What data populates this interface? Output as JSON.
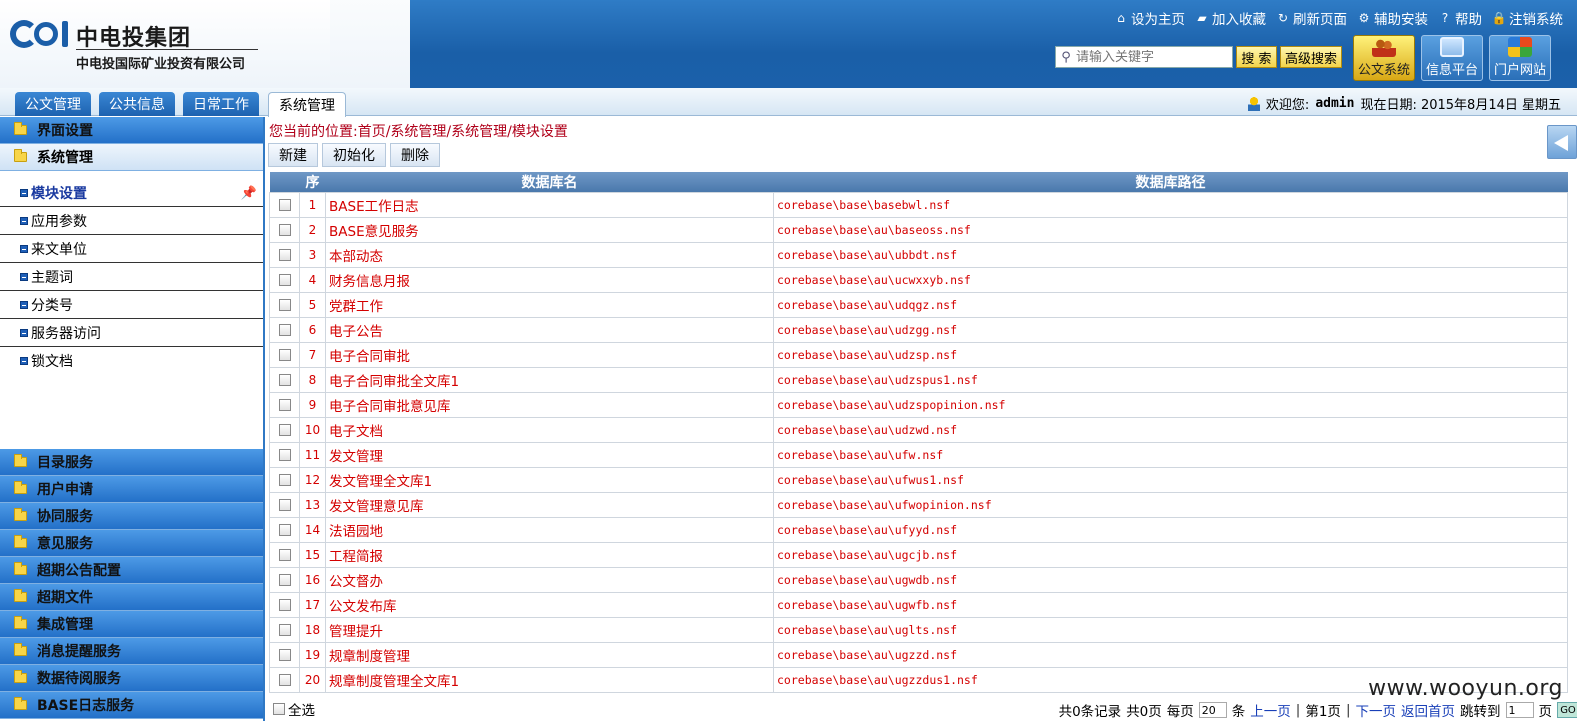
{
  "brand": {
    "title": "中电投集团",
    "subtitle": "中电投国际矿业投资有限公司",
    "color": "#1b5ea8"
  },
  "top_links": [
    {
      "label": "设为主页",
      "icon": "home-icon"
    },
    {
      "label": "加入收藏",
      "icon": "folder-icon"
    },
    {
      "label": "刷新页面",
      "icon": "refresh-icon"
    },
    {
      "label": "辅助安装",
      "icon": "gear-icon"
    },
    {
      "label": "帮助",
      "icon": "help-icon"
    },
    {
      "label": "注销系统",
      "icon": "lock-icon"
    }
  ],
  "search": {
    "placeholder": "请输入关键字",
    "search_label": "搜 索",
    "advanced_label": "高级搜索"
  },
  "apps": [
    {
      "label": "公文系统",
      "icon": "users-icon",
      "active": true
    },
    {
      "label": "信息平台",
      "icon": "monitor-icon",
      "active": false
    },
    {
      "label": "门户网站",
      "icon": "windows-icon",
      "active": false
    }
  ],
  "nav_tabs": [
    {
      "label": "公文管理"
    },
    {
      "label": "公共信息"
    },
    {
      "label": "日常工作"
    },
    {
      "label": "系统管理",
      "active": true
    }
  ],
  "welcome": {
    "text": "欢迎您:",
    "user": "admin",
    "date": "现在日期: 2015年8月14日 星期五"
  },
  "sidebar": {
    "top_groups": [
      {
        "label": "界面设置"
      },
      {
        "label": "系统管理"
      }
    ],
    "items": [
      {
        "label": "模块设置",
        "active": true
      },
      {
        "label": "应用参数"
      },
      {
        "label": "来文单位"
      },
      {
        "label": "主题词"
      },
      {
        "label": "分类号"
      },
      {
        "label": "服务器访问"
      },
      {
        "label": "锁文档"
      }
    ],
    "bottom_groups": [
      {
        "label": "目录服务"
      },
      {
        "label": "用户申请"
      },
      {
        "label": "协同服务"
      },
      {
        "label": "意见服务"
      },
      {
        "label": "超期公告配置"
      },
      {
        "label": "超期文件"
      },
      {
        "label": "集成管理"
      },
      {
        "label": "消息提醒服务"
      },
      {
        "label": "数据待阅服务"
      },
      {
        "label": "BASE日志服务"
      }
    ]
  },
  "breadcrumb": "您当前的位置:首页/系统管理/系统管理/模块设置",
  "toolbar": {
    "new_label": "新建",
    "init_label": "初始化",
    "delete_label": "删除"
  },
  "table": {
    "headers": {
      "seq": "序",
      "name": "数据库名",
      "path": "数据库路径"
    },
    "rows": [
      {
        "seq": "1",
        "name": "BASE工作日志",
        "path": "corebase\\base\\basebwl.nsf"
      },
      {
        "seq": "2",
        "name": "BASE意见服务",
        "path": "corebase\\base\\au\\baseoss.nsf"
      },
      {
        "seq": "3",
        "name": "本部动态",
        "path": "corebase\\base\\au\\ubbdt.nsf"
      },
      {
        "seq": "4",
        "name": "财务信息月报",
        "path": "corebase\\base\\au\\ucwxxyb.nsf"
      },
      {
        "seq": "5",
        "name": "党群工作",
        "path": "corebase\\base\\au\\udqgz.nsf"
      },
      {
        "seq": "6",
        "name": "电子公告",
        "path": "corebase\\base\\au\\udzgg.nsf"
      },
      {
        "seq": "7",
        "name": "电子合同审批",
        "path": "corebase\\base\\au\\udzsp.nsf"
      },
      {
        "seq": "8",
        "name": "电子合同审批全文库1",
        "path": "corebase\\base\\au\\udzspus1.nsf"
      },
      {
        "seq": "9",
        "name": "电子合同审批意见库",
        "path": "corebase\\base\\au\\udzspopinion.nsf"
      },
      {
        "seq": "10",
        "name": "电子文档",
        "path": "corebase\\base\\au\\udzwd.nsf"
      },
      {
        "seq": "11",
        "name": "发文管理",
        "path": "corebase\\base\\au\\ufw.nsf"
      },
      {
        "seq": "12",
        "name": "发文管理全文库1",
        "path": "corebase\\base\\au\\ufwus1.nsf"
      },
      {
        "seq": "13",
        "name": "发文管理意见库",
        "path": "corebase\\base\\au\\ufwopinion.nsf"
      },
      {
        "seq": "14",
        "name": "法语园地",
        "path": "corebase\\base\\au\\ufyyd.nsf"
      },
      {
        "seq": "15",
        "name": "工程简报",
        "path": "corebase\\base\\au\\ugcjb.nsf"
      },
      {
        "seq": "16",
        "name": "公文督办",
        "path": "corebase\\base\\au\\ugwdb.nsf"
      },
      {
        "seq": "17",
        "name": "公文发布库",
        "path": "corebase\\base\\au\\ugwfb.nsf"
      },
      {
        "seq": "18",
        "name": "管理提升",
        "path": "corebase\\base\\au\\uglts.nsf"
      },
      {
        "seq": "19",
        "name": "规章制度管理",
        "path": "corebase\\base\\au\\ugzzd.nsf"
      },
      {
        "seq": "20",
        "name": "规章制度管理全文库1",
        "path": "corebase\\base\\au\\ugzzdus1.nsf"
      }
    ]
  },
  "footer": {
    "select_all": "全选",
    "records": "共0条记录",
    "pages": "共0页",
    "per_page_pre": "每页",
    "per_page_value": "20",
    "per_page_post": "条",
    "prev": "上一页",
    "current": "第1页",
    "next": "下一页",
    "first": "返回首页",
    "jump_pre": "跳转到",
    "jump_value": "1",
    "jump_post": "页",
    "go": "GO"
  },
  "watermark": "www.wooyun.org",
  "colors": {
    "header_blue": "#1a5fa8",
    "link_red": "#d40000",
    "crumb_red": "#b0001a"
  }
}
